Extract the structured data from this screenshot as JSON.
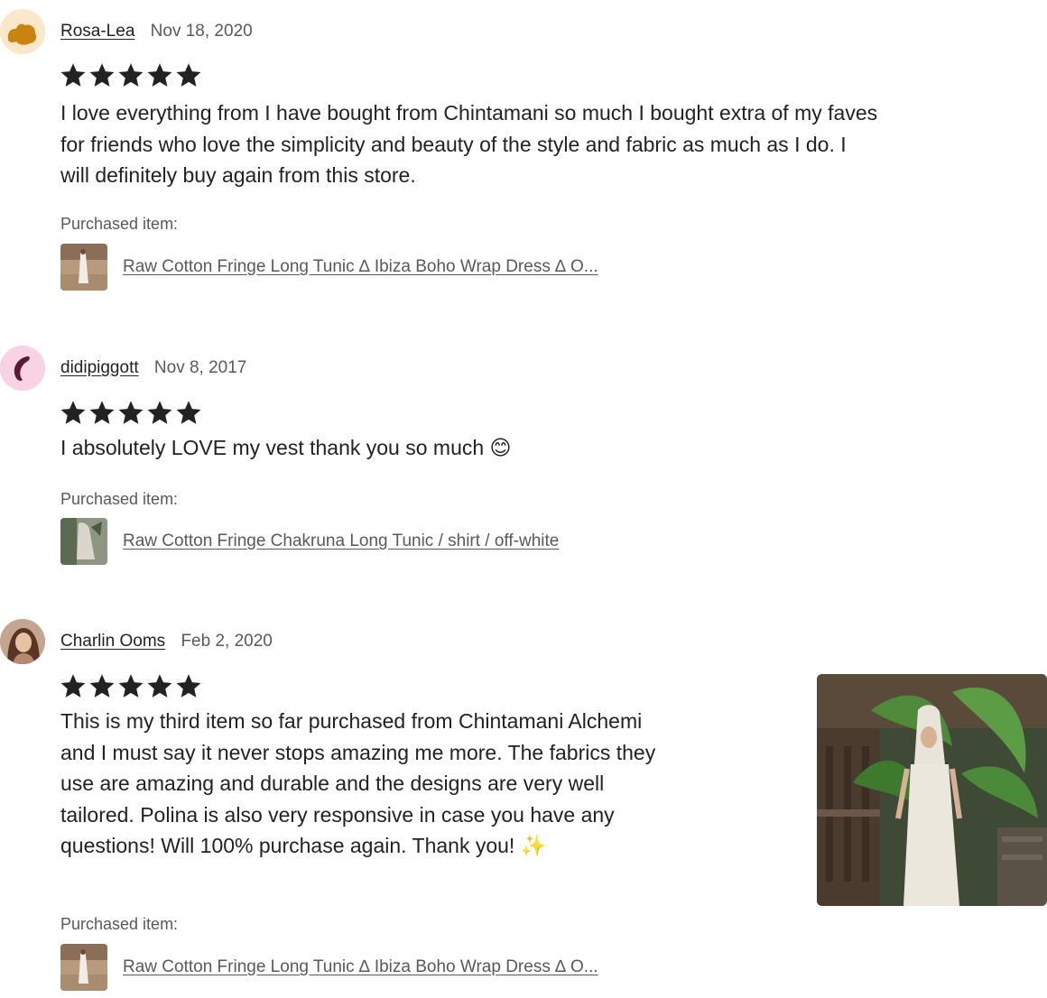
{
  "purchased_label": "Purchased item:",
  "colors": {
    "star": "#222222",
    "link": "#595959",
    "avatar1_bg": "#fbe7c9",
    "avatar1_fg": "#c9840f",
    "avatar2_bg": "#f9d2e3",
    "avatar2_fg": "#5b1a34"
  },
  "reviews": [
    {
      "reviewer": "Rosa-Lea",
      "date": "Nov 18, 2020",
      "rating": 5,
      "avatar_icon": "brown-blob-avatar",
      "text_lines": [
        "I love everything from I have bought from Chintamani so much I bought extra of my faves",
        "for friends who love the simplicity and beauty of the style and fabric as much as I do. I",
        "will definitely buy again from this store."
      ],
      "item_title": "Raw Cotton Fringe Long Tunic ∆ Ibiza Boho Wrap Dress ∆ O..."
    },
    {
      "reviewer": "didipiggott",
      "date": "Nov 8, 2017",
      "rating": 5,
      "avatar_icon": "pink-crescent-avatar",
      "text_lines": [
        "I absolutely LOVE my vest thank you so much 😊"
      ],
      "item_title": "Raw Cotton Fringe Chakruna Long Tunic / shirt / off-white"
    },
    {
      "reviewer": "Charlin Ooms",
      "date": "Feb 2, 2020",
      "rating": 5,
      "avatar_icon": "user-photo-avatar",
      "text_lines": [
        "This is my third item so far purchased from Chintamani Alchemi",
        "and I must say it never stops amazing me more. The fabrics they",
        "use are amazing and durable and the designs are very well",
        "tailored. Polina is also very responsive in case you have any",
        "questions! Will 100% purchase again. Thank you! ✨"
      ],
      "item_title": "Raw Cotton Fringe Long Tunic ∆ Ibiza Boho Wrap Dress ∆ O..."
    }
  ]
}
